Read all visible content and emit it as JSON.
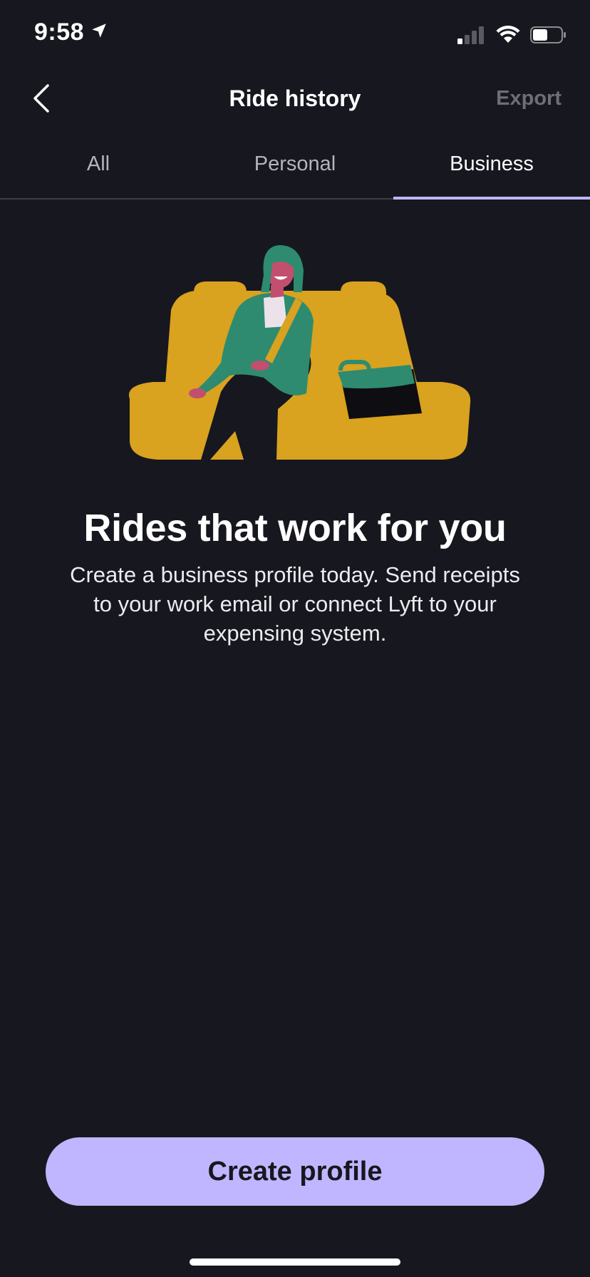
{
  "status_bar": {
    "time": "9:58",
    "icons": [
      "location-arrow-icon",
      "cellular-signal-icon",
      "wifi-icon",
      "battery-icon"
    ]
  },
  "header": {
    "back_icon": "chevron-left-icon",
    "title": "Ride history",
    "export_label": "Export"
  },
  "tabs": [
    {
      "label": "All",
      "active": false
    },
    {
      "label": "Personal",
      "active": false
    },
    {
      "label": "Business",
      "active": true
    }
  ],
  "main": {
    "illustration": "woman-seated-in-car-back-seat-with-briefcase",
    "headline": "Rides that work for you",
    "description": "Create a business profile today. Send receipts to your work email or connect Lyft to your expensing system."
  },
  "cta": {
    "label": "Create profile"
  },
  "colors": {
    "background": "#17171f",
    "accent": "#bfb6ff",
    "seat": "#d9a21f",
    "jacket": "#2e8b70",
    "muted_text": "#6e6e74"
  }
}
